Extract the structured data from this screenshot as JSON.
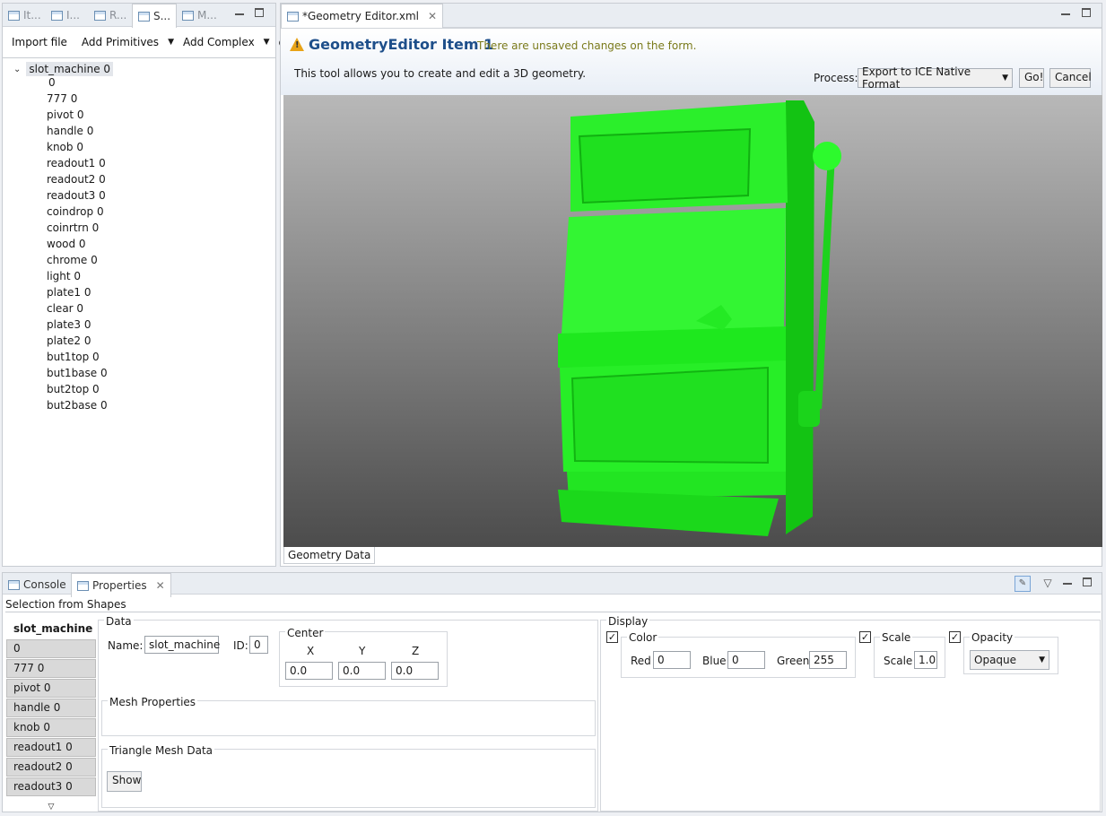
{
  "left_view": {
    "tabs": [
      "It...",
      "I...",
      "R...",
      "S...",
      "M..."
    ],
    "toolbar": {
      "import": "Import file",
      "add_primitives": "Add Primitives",
      "add_complex": "Add Complex"
    },
    "tree": {
      "root": "slot_machine 0",
      "children": [
        "0",
        "777 0",
        "pivot 0",
        "handle 0",
        "knob 0",
        "readout1 0",
        "readout2 0",
        "readout3 0",
        "coindrop 0",
        "coinrtrn 0",
        "wood 0",
        "chrome 0",
        "light 0",
        "plate1 0",
        "clear 0",
        "plate3 0",
        "plate2 0",
        "but1top 0",
        "but1base 0",
        "but2top 0",
        "but2base 0"
      ]
    }
  },
  "editor": {
    "tab_title": "*Geometry Editor.xml",
    "form_title": "GeometryEditor Item 1",
    "unsaved_message": "There are unsaved changes on the form.",
    "description": "This tool allows you to create and edit a 3D geometry.",
    "process_label": "Process:",
    "process_value": "Export to ICE Native Format",
    "go_label": "Go!",
    "cancel_label": "Cancel",
    "bottom_tab": "Geometry Data",
    "model_color": "#22ff22"
  },
  "bottom": {
    "tabs": {
      "console": "Console",
      "properties": "Properties"
    },
    "heading": "Selection from Shapes",
    "selection": [
      "slot_machine 0",
      "0",
      "777 0",
      "pivot 0",
      "handle 0",
      "knob 0",
      "readout1 0",
      "readout2 0",
      "readout3 0"
    ],
    "data": {
      "title": "Data",
      "name_label": "Name:",
      "name_value": "slot_machine",
      "id_label": "ID:",
      "id_value": "0",
      "center_title": "Center",
      "x_label": "X",
      "y_label": "Y",
      "z_label": "Z",
      "x_value": "0.0",
      "y_value": "0.0",
      "z_value": "0.0",
      "mesh_props": "Mesh Properties",
      "tri_mesh": "Triangle Mesh Data",
      "show_label": "Show"
    },
    "display": {
      "title": "Display",
      "color_title": "Color",
      "red_label": "Red",
      "red_value": "0",
      "blue_label": "Blue",
      "blue_value": "0",
      "green_label": "Green",
      "green_value": "255",
      "scale_title": "Scale",
      "scale_label": "Scale",
      "scale_value": "1.0",
      "opacity_title": "Opacity",
      "opacity_value": "Opaque",
      "check_mark": "✓"
    }
  }
}
